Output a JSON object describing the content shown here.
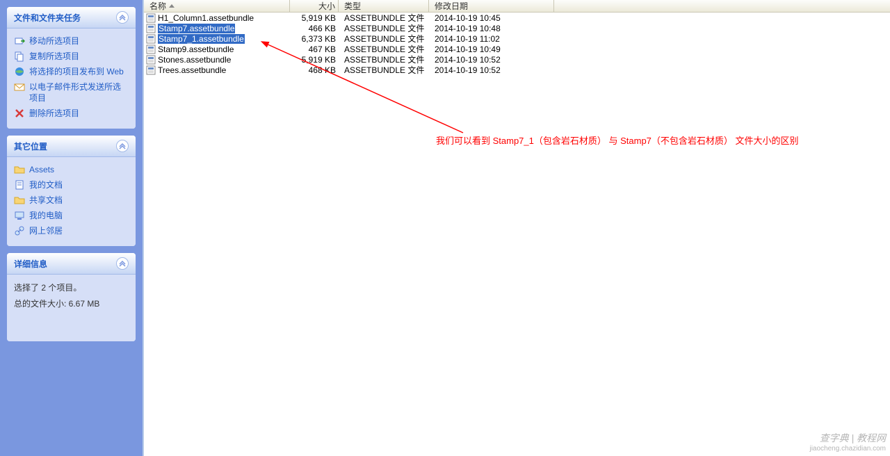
{
  "sidebar": {
    "tasks": {
      "title": "文件和文件夹任务",
      "items": [
        {
          "label": "移动所选项目",
          "icon": "move"
        },
        {
          "label": "复制所选项目",
          "icon": "copy"
        },
        {
          "label": "将选择的项目发布到 Web",
          "icon": "publish"
        },
        {
          "label": "以电子邮件形式发送所选项目",
          "icon": "email"
        },
        {
          "label": "删除所选项目",
          "icon": "delete"
        }
      ]
    },
    "places": {
      "title": "其它位置",
      "items": [
        {
          "label": "Assets",
          "icon": "folder"
        },
        {
          "label": "我的文档",
          "icon": "docs"
        },
        {
          "label": "共享文档",
          "icon": "folder"
        },
        {
          "label": "我的电脑",
          "icon": "computer"
        },
        {
          "label": "网上邻居",
          "icon": "network"
        }
      ]
    },
    "details": {
      "title": "详细信息",
      "line1": "选择了 2 个项目。",
      "line2": "总的文件大小: 6.67 MB"
    }
  },
  "columns": {
    "name": "名称",
    "size": "大小",
    "type": "类型",
    "date": "修改日期"
  },
  "files": [
    {
      "name": "H1_Column1.assetbundle",
      "size": "5,919 KB",
      "type": "ASSETBUNDLE 文件",
      "date": "2014-10-19 10:45",
      "selected": false
    },
    {
      "name": "Stamp7.assetbundle",
      "size": "466 KB",
      "type": "ASSETBUNDLE 文件",
      "date": "2014-10-19 10:48",
      "selected": true
    },
    {
      "name": "Stamp7_1.assetbundle",
      "size": "6,373 KB",
      "type": "ASSETBUNDLE 文件",
      "date": "2014-10-19 11:02",
      "selected": true
    },
    {
      "name": "Stamp9.assetbundle",
      "size": "467 KB",
      "type": "ASSETBUNDLE 文件",
      "date": "2014-10-19 10:49",
      "selected": false
    },
    {
      "name": "Stones.assetbundle",
      "size": "5,919 KB",
      "type": "ASSETBUNDLE 文件",
      "date": "2014-10-19 10:52",
      "selected": false
    },
    {
      "name": "Trees.assetbundle",
      "size": "468 KB",
      "type": "ASSETBUNDLE 文件",
      "date": "2014-10-19 10:52",
      "selected": false
    }
  ],
  "annotation": "我们可以看到 Stamp7_1（包含岩石材质） 与 Stamp7（不包含岩石材质） 文件大小的区别",
  "watermark": {
    "line1": "查字典 | 教程网",
    "line2": "jiaocheng.chazidian.com"
  }
}
